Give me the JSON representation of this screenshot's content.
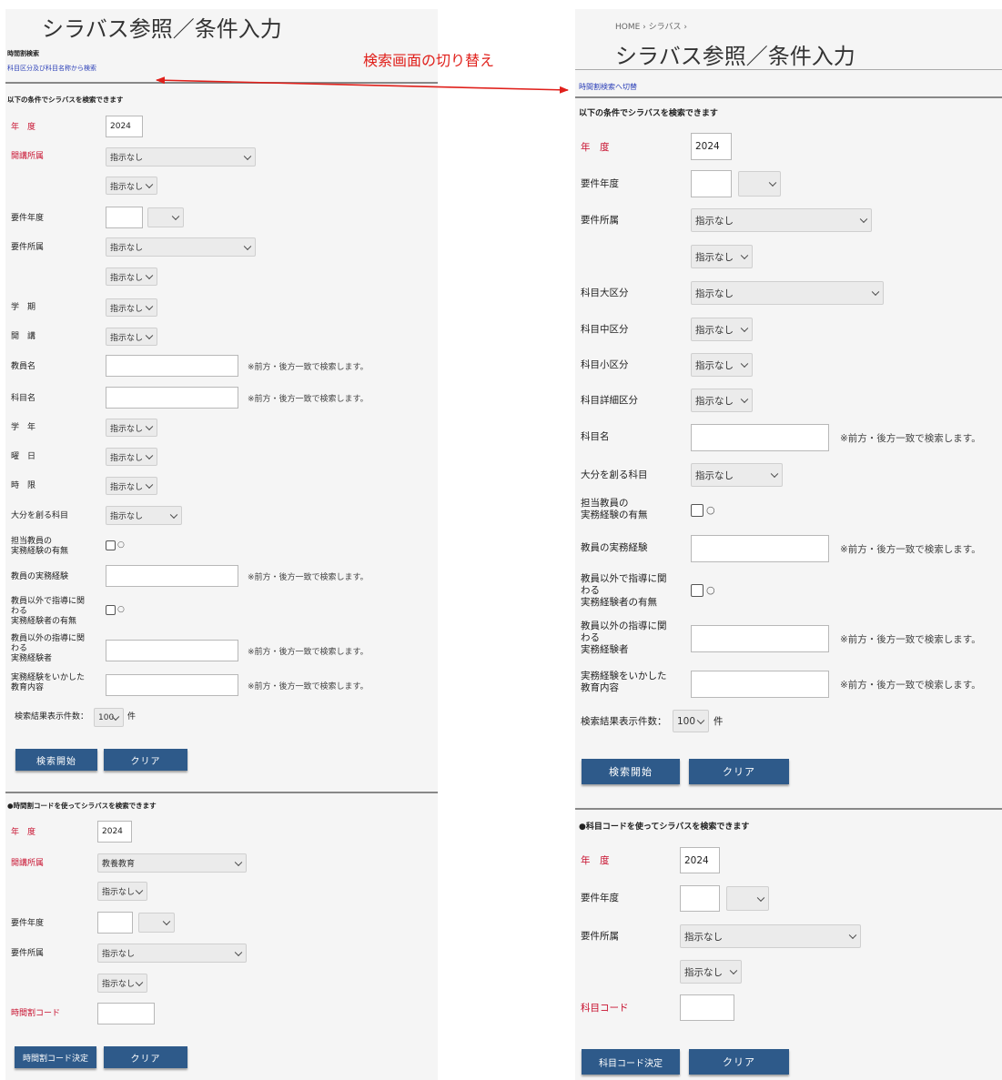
{
  "annotation": {
    "text": "検索画面の切り替え"
  },
  "left": {
    "title": "シラバス参照／条件入力",
    "section_label": "時間割検索",
    "switch_link": "科目区分及び科目名称から検索",
    "form_heading": "以下の条件でシラバスを検索できます",
    "fields": {
      "year": {
        "label": "年　度",
        "value": "2024"
      },
      "offering": {
        "label": "開講所属",
        "select": "指示なし",
        "sub": "指示なし"
      },
      "req_year": {
        "label": "要件年度"
      },
      "req_dept": {
        "label": "要件所属",
        "select": "指示なし",
        "sub": "指示なし"
      },
      "term": {
        "label": "学　期",
        "select": "指示なし"
      },
      "kaiko": {
        "label": "開　講",
        "select": "指示なし"
      },
      "teacher": {
        "label": "教員名",
        "note": "※前方・後方一致で検索します。"
      },
      "subject": {
        "label": "科目名",
        "note": "※前方・後方一致で検索します。"
      },
      "grade": {
        "label": "学　年",
        "select": "指示なし"
      },
      "weekday": {
        "label": "曜　日",
        "select": "指示なし"
      },
      "period": {
        "label": "時　限",
        "select": "指示なし"
      },
      "oita": {
        "label": "大分を創る科目",
        "select": "指示なし"
      },
      "exp_flag": {
        "label1": "担当教員の",
        "label2": "実務経験の有無",
        "circle": "○"
      },
      "exp_text": {
        "label": "教員の実務経験",
        "note": "※前方・後方一致で検索します。"
      },
      "other_flag": {
        "label1": "教員以外で指導に関",
        "label2": "わる",
        "label3": "実務経験者の有無",
        "circle": "○"
      },
      "other_text": {
        "label1": "教員以外の指導に関",
        "label2": "わる",
        "label3": "実務経験者",
        "note": "※前方・後方一致で検索します。"
      },
      "content": {
        "label1": "実務経験をいかした",
        "label2": "教育内容",
        "note": "※前方・後方一致で検索します。"
      },
      "count": {
        "label": "検索結果表示件数：",
        "select": "100",
        "unit": "件"
      }
    },
    "search_button": "検索開始",
    "clear_button": "クリア",
    "code_heading": "●時間割コードを使ってシラバスを検索できます",
    "code": {
      "year": {
        "label": "年　度",
        "value": "2024"
      },
      "offering": {
        "label": "開講所属",
        "select": "教養教育",
        "sub": "指示なし"
      },
      "req_year": {
        "label": "要件年度"
      },
      "req_dept": {
        "label": "要件所属",
        "select": "指示なし",
        "sub": "指示なし"
      },
      "code_label": "時間割コード",
      "submit_button": "時間割コード決定",
      "clear_button": "クリア"
    }
  },
  "right": {
    "breadcrumb": "HOME › シラバス ›",
    "title": "シラバス参照／条件入力",
    "switch_link": "時間割検索へ切替",
    "form_heading": "以下の条件でシラバスを検索できます",
    "fields": {
      "year": {
        "label": "年　度",
        "value": "2024"
      },
      "req_year": {
        "label": "要件年度"
      },
      "req_dept": {
        "label": "要件所属",
        "select": "指示なし",
        "sub": "指示なし"
      },
      "major": {
        "label": "科目大区分",
        "select": "指示なし"
      },
      "middle": {
        "label": "科目中区分",
        "select": "指示なし"
      },
      "minor": {
        "label": "科目小区分",
        "select": "指示なし"
      },
      "detail": {
        "label": "科目詳細区分",
        "select": "指示なし"
      },
      "subject": {
        "label": "科目名",
        "note": "※前方・後方一致で検索します。"
      },
      "oita": {
        "label": "大分を創る科目",
        "select": "指示なし"
      },
      "exp_flag": {
        "label1": "担当教員の",
        "label2": "実務経験の有無",
        "circle": "○"
      },
      "exp_text": {
        "label": "教員の実務経験",
        "note": "※前方・後方一致で検索します。"
      },
      "other_flag": {
        "label1": "教員以外で指導に関",
        "label2": "わる",
        "label3": "実務経験者の有無",
        "circle": "○"
      },
      "other_text": {
        "label1": "教員以外の指導に関",
        "label2": "わる",
        "label3": "実務経験者",
        "note": "※前方・後方一致で検索します。"
      },
      "content": {
        "label1": "実務経験をいかした",
        "label2": "教育内容",
        "note": "※前方・後方一致で検索します。"
      },
      "count": {
        "label": "検索結果表示件数：",
        "select": "100",
        "unit": "件"
      }
    },
    "search_button": "検索開始",
    "clear_button": "クリア",
    "code_heading": "●科目コードを使ってシラバスを検索できます",
    "code": {
      "year": {
        "label": "年　度",
        "value": "2024"
      },
      "req_year": {
        "label": "要件年度"
      },
      "req_dept": {
        "label": "要件所属",
        "select": "指示なし",
        "sub": "指示なし"
      },
      "code_label": "科目コード",
      "submit_button": "科目コード決定",
      "clear_button": "クリア"
    }
  }
}
